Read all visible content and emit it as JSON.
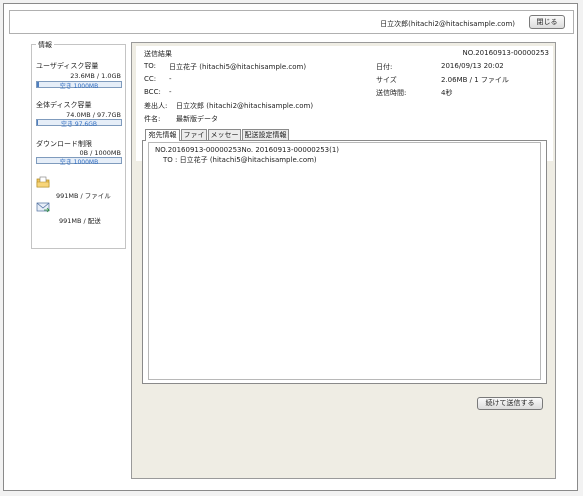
{
  "header": {
    "user": "日立次郎(hitachi2@hitachisample.com)",
    "close_label": "閉じる"
  },
  "sidebar": {
    "title": "情報",
    "user_disk": {
      "label": "ユーザディスク容量",
      "value": "23.6MB / 1.0GB",
      "bar_text": "空き 1000MB",
      "used_fraction": 0.02
    },
    "total_disk": {
      "label": "全体ディスク容量",
      "value": "74.0MB / 97.7GB",
      "bar_text": "空き 97.6GB",
      "used_fraction": 0.01
    },
    "download": {
      "label": "ダウンロード制限",
      "value": "0B / 1000MB",
      "bar_text": "空き 1000MB",
      "used_fraction": 0.0
    },
    "file_limit": {
      "icon": "folder-file-icon",
      "value": "991MB / ファイル"
    },
    "send_limit": {
      "icon": "mail-send-icon",
      "value": "991MB / 配送"
    }
  },
  "result": {
    "title": "送信結果",
    "id": "NO.20160913-00000253",
    "to_label": "TO:",
    "to_value": "日立花子 (hitachi5@hitachisample.com)",
    "cc_label": "CC:",
    "cc_value": "-",
    "bcc_label": "BCC:",
    "bcc_value": "-",
    "sender_label": "差出人:",
    "sender_value": "日立次郎 (hitachi2@hitachisample.com)",
    "subject_label": "件名:",
    "subject_value": "最新版データ",
    "date_label": "日付:",
    "date_value": "2016/09/13 20:02",
    "size_label": "サイズ",
    "size_value": "2.06MB / 1 ファイル",
    "time_label": "送信時間:",
    "time_value": "4秒"
  },
  "tabs": [
    {
      "label": "宛先情報",
      "active": true
    },
    {
      "label": "ファイル",
      "active": false
    },
    {
      "label": "メッセージ",
      "active": false
    },
    {
      "label": "配送設定情報",
      "active": false
    }
  ],
  "recipient_info": {
    "line1": "NO.20160913-00000253No. 20160913-00000253(1)",
    "line2": "TO : 日立花子 (hitachi5@hitachisample.com)"
  },
  "continue_label": "続けて送信する"
}
